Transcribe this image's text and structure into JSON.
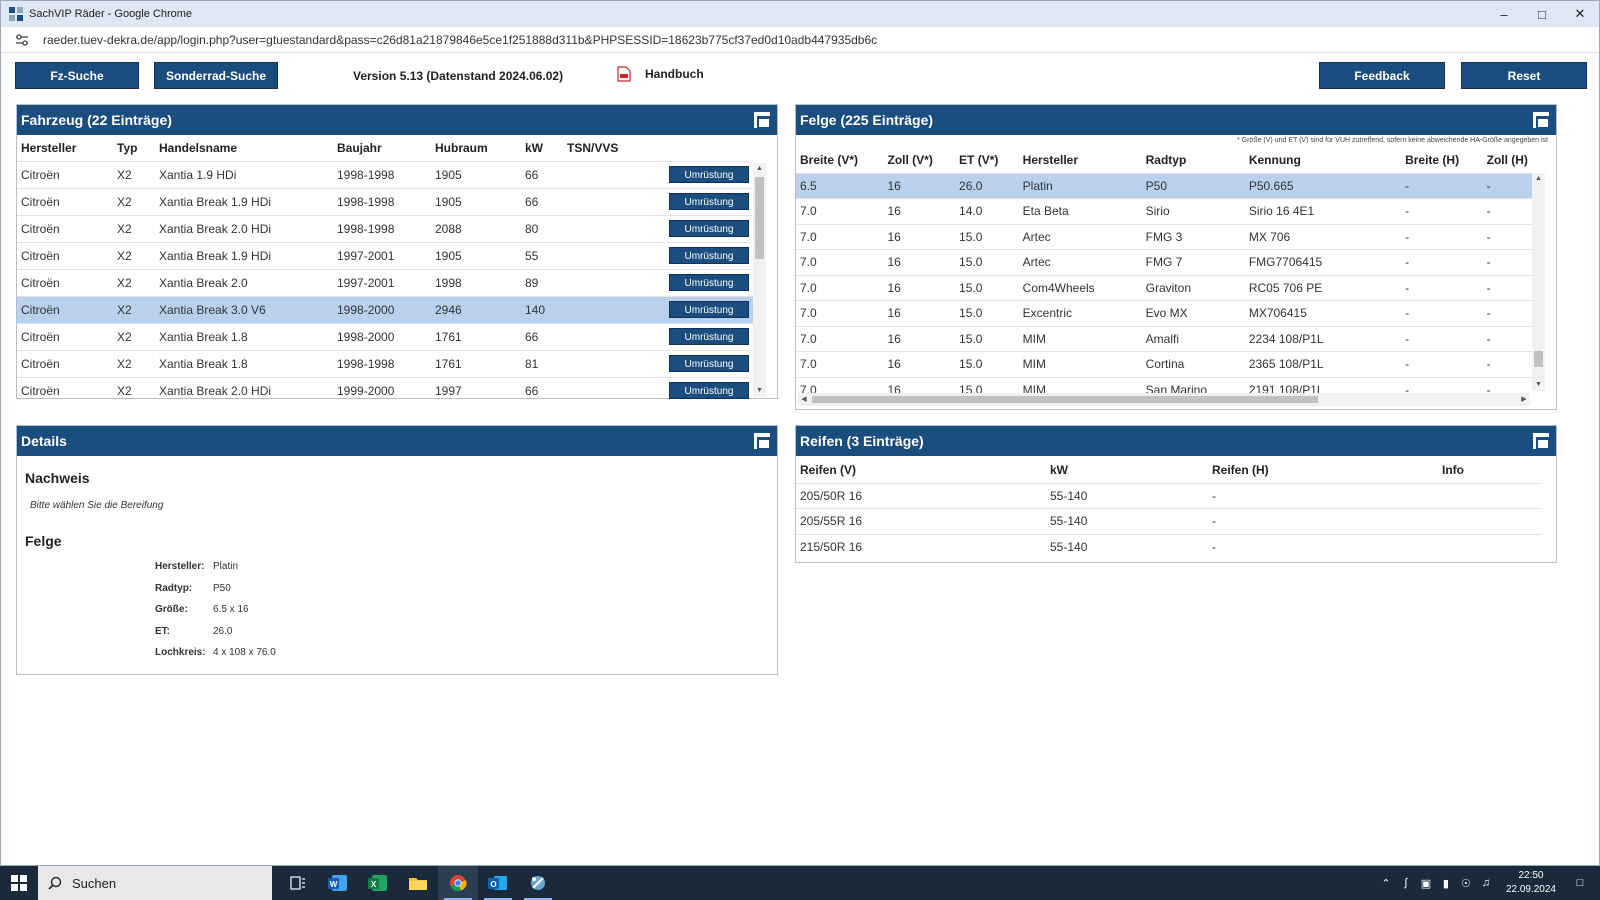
{
  "browser": {
    "title": "SachVIP Räder - Google Chrome",
    "url": "raeder.tuev-dekra.de/app/login.php?user=gtuestandard&pass=c26d81a21879846e5ce1f251888d311b&PHPSESSID=18623b775cf37ed0d10adb447935db6c"
  },
  "toolbar": {
    "fz_suche": "Fz-Suche",
    "sonderrad_suche": "Sonderrad-Suche",
    "version": "Version 5.13 (Datenstand 2024.06.02)",
    "handbuch": "Handbuch",
    "feedback": "Feedback",
    "reset": "Reset"
  },
  "fahrzeug": {
    "title": "Fahrzeug (22 Einträge)",
    "columns": [
      "Hersteller",
      "Typ",
      "Handelsname",
      "Baujahr",
      "Hubraum",
      "kW",
      "TSN/VVS"
    ],
    "button_label": "Umrüstung",
    "rows": [
      [
        "Citroën",
        "X2",
        "Xantia 1.9 HDi",
        "1998-1998",
        "1905",
        "66",
        ""
      ],
      [
        "Citroën",
        "X2",
        "Xantia Break 1.9 HDi",
        "1998-1998",
        "1905",
        "66",
        ""
      ],
      [
        "Citroën",
        "X2",
        "Xantia Break 2.0 HDi",
        "1998-1998",
        "2088",
        "80",
        ""
      ],
      [
        "Citroën",
        "X2",
        "Xantia Break 1.9 HDi",
        "1997-2001",
        "1905",
        "55",
        ""
      ],
      [
        "Citroën",
        "X2",
        "Xantia Break 2.0",
        "1997-2001",
        "1998",
        "89",
        ""
      ],
      [
        "Citroën",
        "X2",
        "Xantia Break 3.0 V6",
        "1998-2000",
        "2946",
        "140",
        ""
      ],
      [
        "Citroën",
        "X2",
        "Xantia Break 1.8",
        "1998-2000",
        "1761",
        "66",
        ""
      ],
      [
        "Citroën",
        "X2",
        "Xantia Break 1.8",
        "1998-1998",
        "1761",
        "81",
        ""
      ],
      [
        "Citroën",
        "X2",
        "Xantia Break 2.0 HDi",
        "1999-2000",
        "1997",
        "66",
        ""
      ]
    ],
    "selected_index": 5
  },
  "felge": {
    "title": "Felge (225 Einträge)",
    "hint": "* Größe (V) und ET (V) sind für VUH zutreffend, sofern keine abweichende HA-Größe angegeben ist",
    "columns": [
      "Breite (V*)",
      "Zoll (V*)",
      "ET (V*)",
      "Hersteller",
      "Radtyp",
      "Kennung",
      "Breite (H)",
      "Zoll (H)"
    ],
    "rows": [
      [
        "6.5",
        "16",
        "26.0",
        "Platin",
        "P50",
        "P50.665",
        "-",
        "-"
      ],
      [
        "7.0",
        "16",
        "14.0",
        "Eta Beta",
        "Sirio",
        "Sirio 16 4E1",
        "-",
        "-"
      ],
      [
        "7.0",
        "16",
        "15.0",
        "Artec",
        "FMG 3",
        "MX 706",
        "-",
        "-"
      ],
      [
        "7.0",
        "16",
        "15.0",
        "Artec",
        "FMG 7",
        "FMG7706415",
        "-",
        "-"
      ],
      [
        "7.0",
        "16",
        "15.0",
        "Com4Wheels",
        "Graviton",
        "RC05 706 PE",
        "-",
        "-"
      ],
      [
        "7.0",
        "16",
        "15.0",
        "Excentric",
        "Evo MX",
        "MX706415",
        "-",
        "-"
      ],
      [
        "7.0",
        "16",
        "15.0",
        "MIM",
        "Amalfi",
        "2234 108/P1L",
        "-",
        "-"
      ],
      [
        "7.0",
        "16",
        "15.0",
        "MIM",
        "Cortina",
        "2365 108/P1L",
        "-",
        "-"
      ],
      [
        "7.0",
        "16",
        "15.0",
        "MIM",
        "San Marino",
        "2191 108/P1L",
        "-",
        "-"
      ]
    ],
    "selected_index": 0
  },
  "details": {
    "title": "Details",
    "nachweis_heading": "Nachweis",
    "nachweis_text": "Bitte wählen Sie die Bereifung",
    "felge_heading": "Felge",
    "fields": [
      {
        "label": "Hersteller:",
        "value": "Platin"
      },
      {
        "label": "Radtyp:",
        "value": "P50"
      },
      {
        "label": "Größe:",
        "value": "6.5 x 16"
      },
      {
        "label": "ET:",
        "value": "26.0"
      },
      {
        "label": "Lochkreis:",
        "value": "4 x 108 x 76.0"
      }
    ]
  },
  "reifen": {
    "title": "Reifen (3 Einträge)",
    "columns": [
      "Reifen (V)",
      "kW",
      "Reifen (H)",
      "Info"
    ],
    "rows": [
      [
        "205/50R 16",
        "55-140",
        "-",
        ""
      ],
      [
        "205/55R 16",
        "55-140",
        "-",
        ""
      ],
      [
        "215/50R 16",
        "55-140",
        "-",
        ""
      ]
    ]
  },
  "taskbar": {
    "search_label": "Suchen",
    "time": "22:50",
    "date": "22.09.2024"
  },
  "colors": {
    "header_blue": "#1b4d7e",
    "selected_row": "#b9d1ec"
  }
}
